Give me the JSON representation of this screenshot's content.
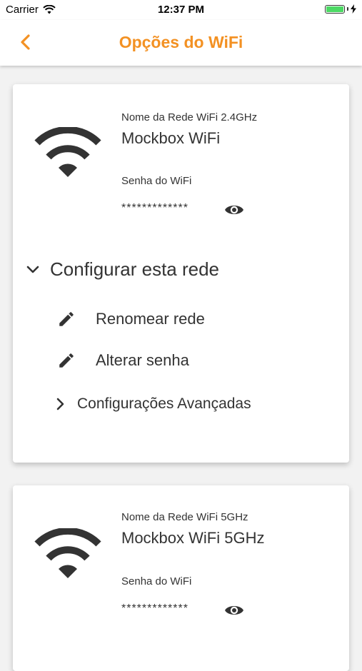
{
  "status": {
    "carrier": "Carrier",
    "time": "12:37 PM",
    "battery_level": 1.0
  },
  "header": {
    "title": "Opções do WiFi"
  },
  "network_24": {
    "name_label": "Nome da Rede WiFi 2.4GHz",
    "name": "Mockbox WiFi",
    "password_label": "Senha do WiFi",
    "password": "*************",
    "config_title": "Configurar esta rede",
    "rename_label": "Renomear rede",
    "change_password_label": "Alterar senha",
    "advanced_label": "Configurações Avançadas"
  },
  "network_5": {
    "name_label": "Nome da Rede WiFi 5GHz",
    "name": "Mockbox WiFi 5GHz",
    "password_label": "Senha do WiFi",
    "password": "*************"
  },
  "colors": {
    "accent": "#f39123",
    "text": "#333333",
    "background": "#f2f2f2"
  },
  "icons": [
    "wifi-signal-icon",
    "back-chevron-icon",
    "eye-icon",
    "chevron-down-icon",
    "pencil-icon",
    "chevron-right-icon"
  ]
}
